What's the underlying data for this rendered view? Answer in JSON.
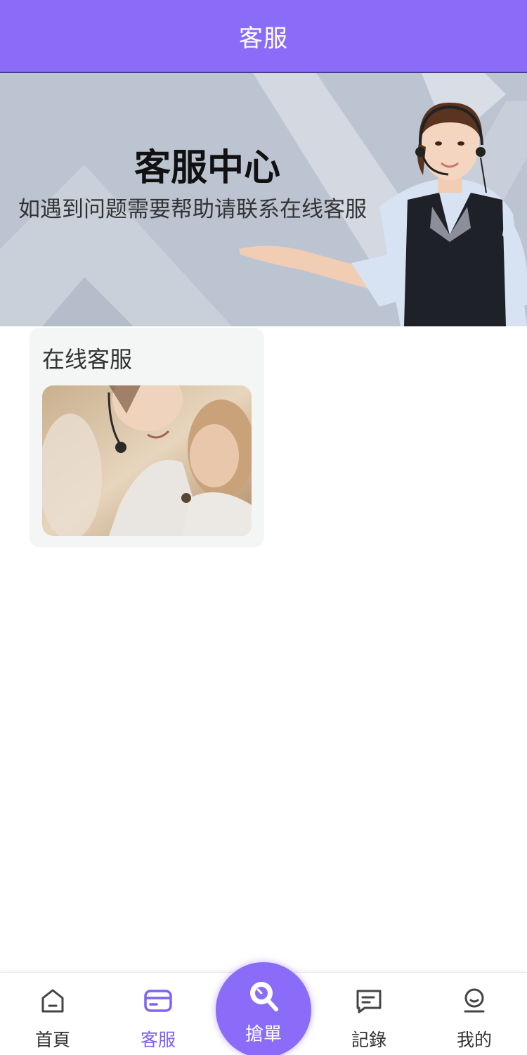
{
  "header": {
    "title": "客服"
  },
  "banner": {
    "title": "客服中心",
    "subtitle": "如遇到问题需要帮助请联系在线客服"
  },
  "service_card": {
    "title": "在线客服"
  },
  "bottom_nav": {
    "items": [
      {
        "label": "首頁",
        "icon": "home-icon"
      },
      {
        "label": "客服",
        "icon": "card-icon",
        "active": true
      },
      {
        "label": "搶單",
        "icon": "search-icon"
      },
      {
        "label": "記錄",
        "icon": "message-icon"
      },
      {
        "label": "我的",
        "icon": "profile-icon"
      }
    ]
  },
  "colors": {
    "primary": "#8a6cf9",
    "active_text": "#7f62f0",
    "banner_bg": "#bcc4d2",
    "card_bg": "#f3f6f5"
  }
}
